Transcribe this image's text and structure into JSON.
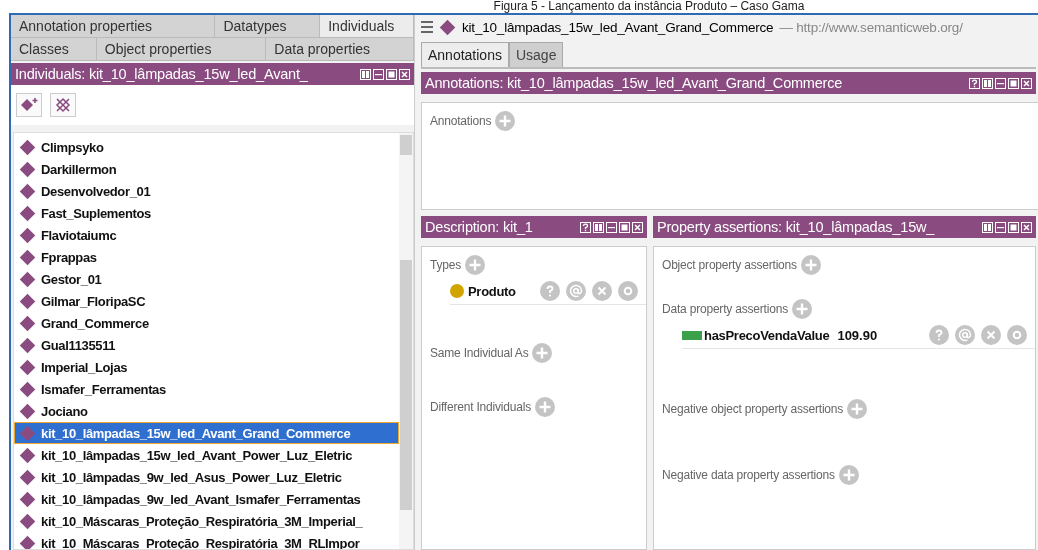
{
  "caption": "Figura 5 - Lançamento da instância Produto – Caso Gama",
  "left_tabs": [
    [
      {
        "label": "Annotation properties",
        "selected": false
      },
      {
        "label": "Datatypes",
        "selected": false
      },
      {
        "label": "Individuals",
        "selected": true
      }
    ],
    [
      {
        "label": "Classes",
        "selected": false
      },
      {
        "label": "Object properties",
        "selected": false
      },
      {
        "label": "Data properties",
        "selected": false
      }
    ]
  ],
  "individuals_view": {
    "title": "Individuals: kit_10_lâmpadas_15w_led_Avant_",
    "buttons": [
      {
        "kind": "split"
      },
      {
        "kind": "stack"
      },
      {
        "kind": "maximize"
      },
      {
        "kind": "close"
      }
    ],
    "items": [
      {
        "label": "Climpsyko",
        "selected": false
      },
      {
        "label": "Darkillermon",
        "selected": false
      },
      {
        "label": "Desenvolvedor_01",
        "selected": false
      },
      {
        "label": "Fast_Suplementos",
        "selected": false
      },
      {
        "label": "Flaviotaiumc",
        "selected": false
      },
      {
        "label": "Fprappas",
        "selected": false
      },
      {
        "label": "Gestor_01",
        "selected": false
      },
      {
        "label": "Gilmar_FloripaSC",
        "selected": false
      },
      {
        "label": "Grand_Commerce",
        "selected": false
      },
      {
        "label": "Gual1135511",
        "selected": false
      },
      {
        "label": "Imperial_Lojas",
        "selected": false
      },
      {
        "label": "Ismafer_Ferramentas",
        "selected": false
      },
      {
        "label": "Jociano",
        "selected": false
      },
      {
        "label": "kit_10_lâmpadas_15w_led_Avant_Grand_Commerce",
        "selected": true
      },
      {
        "label": "kit_10_lâmpadas_15w_led_Avant_Power_Luz_Eletric",
        "selected": false
      },
      {
        "label": "kit_10_lâmpadas_9w_led_Asus_Power_Luz_Eletric",
        "selected": false
      },
      {
        "label": "kit_10_lâmpadas_9w_led_Avant_Ismafer_Ferramentas",
        "selected": false
      },
      {
        "label": "kit_10_Máscaras_Proteção_Respiratória_3M_Imperial_",
        "selected": false
      },
      {
        "label": "kit_10_Máscaras_Proteção_Respiratória_3M_RLImpor",
        "selected": false
      }
    ]
  },
  "entity": {
    "name": "kit_10_lâmpadas_15w_led_Avant_Grand_Commerce",
    "iri": "— http://www.semanticweb.org/"
  },
  "right_tabs": [
    {
      "label": "Annotations",
      "selected": true
    },
    {
      "label": "Usage",
      "selected": false
    }
  ],
  "annotations_view": {
    "title": "Annotations: kit_10_lâmpadas_15w_led_Avant_Grand_Commerce",
    "buttons": [
      {
        "kind": "help"
      },
      {
        "kind": "split"
      },
      {
        "kind": "stack"
      },
      {
        "kind": "maximize"
      },
      {
        "kind": "close"
      }
    ],
    "sections": [
      {
        "label": "Annotations"
      }
    ]
  },
  "description_view": {
    "title": "Description: kit_1",
    "buttons": [
      {
        "kind": "help"
      },
      {
        "kind": "split"
      },
      {
        "kind": "stack"
      },
      {
        "kind": "maximize"
      },
      {
        "kind": "close"
      }
    ],
    "sections": [
      {
        "label": "Types",
        "items": [
          {
            "kind": "class",
            "label": "Produto"
          }
        ]
      },
      {
        "label": "Same Individual As"
      },
      {
        "label": "Different Individuals"
      }
    ]
  },
  "property_view": {
    "title": "Property assertions: kit_10_lâmpadas_15w_",
    "buttons": [
      {
        "kind": "split"
      },
      {
        "kind": "stack"
      },
      {
        "kind": "maximize"
      },
      {
        "kind": "close"
      }
    ],
    "sections": [
      {
        "label": "Object property assertions"
      },
      {
        "label": "Data property assertions",
        "items": [
          {
            "kind": "data",
            "label": "hasPrecoVendaValue",
            "value": "109.90"
          }
        ]
      },
      {
        "label": "Negative object property assertions"
      },
      {
        "label": "Negative data property assertions"
      }
    ]
  }
}
